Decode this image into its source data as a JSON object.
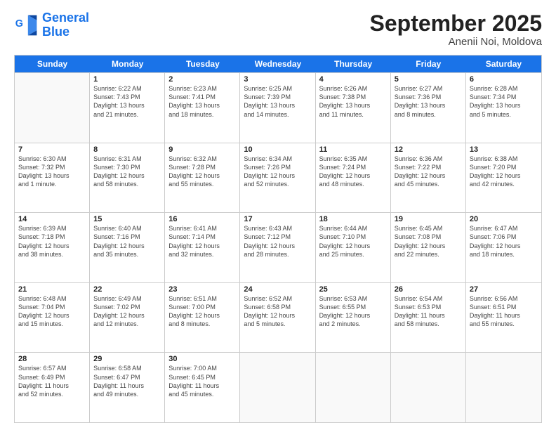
{
  "logo": {
    "line1": "General",
    "line2": "Blue"
  },
  "title": "September 2025",
  "subtitle": "Anenii Noi, Moldova",
  "header_days": [
    "Sunday",
    "Monday",
    "Tuesday",
    "Wednesday",
    "Thursday",
    "Friday",
    "Saturday"
  ],
  "rows": [
    [
      {
        "day": "",
        "info": ""
      },
      {
        "day": "1",
        "info": "Sunrise: 6:22 AM\nSunset: 7:43 PM\nDaylight: 13 hours\nand 21 minutes."
      },
      {
        "day": "2",
        "info": "Sunrise: 6:23 AM\nSunset: 7:41 PM\nDaylight: 13 hours\nand 18 minutes."
      },
      {
        "day": "3",
        "info": "Sunrise: 6:25 AM\nSunset: 7:39 PM\nDaylight: 13 hours\nand 14 minutes."
      },
      {
        "day": "4",
        "info": "Sunrise: 6:26 AM\nSunset: 7:38 PM\nDaylight: 13 hours\nand 11 minutes."
      },
      {
        "day": "5",
        "info": "Sunrise: 6:27 AM\nSunset: 7:36 PM\nDaylight: 13 hours\nand 8 minutes."
      },
      {
        "day": "6",
        "info": "Sunrise: 6:28 AM\nSunset: 7:34 PM\nDaylight: 13 hours\nand 5 minutes."
      }
    ],
    [
      {
        "day": "7",
        "info": "Sunrise: 6:30 AM\nSunset: 7:32 PM\nDaylight: 13 hours\nand 1 minute."
      },
      {
        "day": "8",
        "info": "Sunrise: 6:31 AM\nSunset: 7:30 PM\nDaylight: 12 hours\nand 58 minutes."
      },
      {
        "day": "9",
        "info": "Sunrise: 6:32 AM\nSunset: 7:28 PM\nDaylight: 12 hours\nand 55 minutes."
      },
      {
        "day": "10",
        "info": "Sunrise: 6:34 AM\nSunset: 7:26 PM\nDaylight: 12 hours\nand 52 minutes."
      },
      {
        "day": "11",
        "info": "Sunrise: 6:35 AM\nSunset: 7:24 PM\nDaylight: 12 hours\nand 48 minutes."
      },
      {
        "day": "12",
        "info": "Sunrise: 6:36 AM\nSunset: 7:22 PM\nDaylight: 12 hours\nand 45 minutes."
      },
      {
        "day": "13",
        "info": "Sunrise: 6:38 AM\nSunset: 7:20 PM\nDaylight: 12 hours\nand 42 minutes."
      }
    ],
    [
      {
        "day": "14",
        "info": "Sunrise: 6:39 AM\nSunset: 7:18 PM\nDaylight: 12 hours\nand 38 minutes."
      },
      {
        "day": "15",
        "info": "Sunrise: 6:40 AM\nSunset: 7:16 PM\nDaylight: 12 hours\nand 35 minutes."
      },
      {
        "day": "16",
        "info": "Sunrise: 6:41 AM\nSunset: 7:14 PM\nDaylight: 12 hours\nand 32 minutes."
      },
      {
        "day": "17",
        "info": "Sunrise: 6:43 AM\nSunset: 7:12 PM\nDaylight: 12 hours\nand 28 minutes."
      },
      {
        "day": "18",
        "info": "Sunrise: 6:44 AM\nSunset: 7:10 PM\nDaylight: 12 hours\nand 25 minutes."
      },
      {
        "day": "19",
        "info": "Sunrise: 6:45 AM\nSunset: 7:08 PM\nDaylight: 12 hours\nand 22 minutes."
      },
      {
        "day": "20",
        "info": "Sunrise: 6:47 AM\nSunset: 7:06 PM\nDaylight: 12 hours\nand 18 minutes."
      }
    ],
    [
      {
        "day": "21",
        "info": "Sunrise: 6:48 AM\nSunset: 7:04 PM\nDaylight: 12 hours\nand 15 minutes."
      },
      {
        "day": "22",
        "info": "Sunrise: 6:49 AM\nSunset: 7:02 PM\nDaylight: 12 hours\nand 12 minutes."
      },
      {
        "day": "23",
        "info": "Sunrise: 6:51 AM\nSunset: 7:00 PM\nDaylight: 12 hours\nand 8 minutes."
      },
      {
        "day": "24",
        "info": "Sunrise: 6:52 AM\nSunset: 6:58 PM\nDaylight: 12 hours\nand 5 minutes."
      },
      {
        "day": "25",
        "info": "Sunrise: 6:53 AM\nSunset: 6:55 PM\nDaylight: 12 hours\nand 2 minutes."
      },
      {
        "day": "26",
        "info": "Sunrise: 6:54 AM\nSunset: 6:53 PM\nDaylight: 11 hours\nand 58 minutes."
      },
      {
        "day": "27",
        "info": "Sunrise: 6:56 AM\nSunset: 6:51 PM\nDaylight: 11 hours\nand 55 minutes."
      }
    ],
    [
      {
        "day": "28",
        "info": "Sunrise: 6:57 AM\nSunset: 6:49 PM\nDaylight: 11 hours\nand 52 minutes."
      },
      {
        "day": "29",
        "info": "Sunrise: 6:58 AM\nSunset: 6:47 PM\nDaylight: 11 hours\nand 49 minutes."
      },
      {
        "day": "30",
        "info": "Sunrise: 7:00 AM\nSunset: 6:45 PM\nDaylight: 11 hours\nand 45 minutes."
      },
      {
        "day": "",
        "info": ""
      },
      {
        "day": "",
        "info": ""
      },
      {
        "day": "",
        "info": ""
      },
      {
        "day": "",
        "info": ""
      }
    ]
  ]
}
